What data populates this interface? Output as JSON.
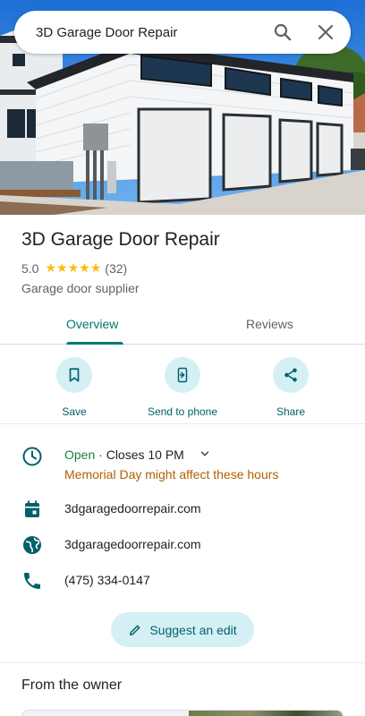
{
  "search": {
    "query": "3D Garage Door Repair",
    "search_icon": "search-icon",
    "close_icon": "close-icon"
  },
  "place": {
    "name": "3D Garage Door Repair",
    "rating": "5.0",
    "review_count": "(32)",
    "stars": 5,
    "category": "Garage door supplier"
  },
  "tabs": [
    {
      "label": "Overview",
      "active": true
    },
    {
      "label": "Reviews",
      "active": false
    }
  ],
  "actions": [
    {
      "label": "Save",
      "icon": "bookmark-icon"
    },
    {
      "label": "Send to phone",
      "icon": "send-to-phone-icon"
    },
    {
      "label": "Share",
      "icon": "share-icon"
    }
  ],
  "hours": {
    "status": "Open",
    "separator": " · ",
    "closes": "Closes 10 PM",
    "notice": "Memorial Day might affect these hours"
  },
  "info": {
    "menu_link": "3dgaragedoorrepair.com",
    "website": "3dgaragedoorrepair.com",
    "phone": "(475) 334-0147"
  },
  "suggest_edit": {
    "label": "Suggest an edit"
  },
  "owner_section": {
    "title": "From the owner"
  },
  "colors": {
    "accent": "#00796b",
    "open_green": "#188038",
    "notice_amber": "#b06000",
    "chip_bg": "#d4f0f5",
    "star": "#fbbc04"
  }
}
